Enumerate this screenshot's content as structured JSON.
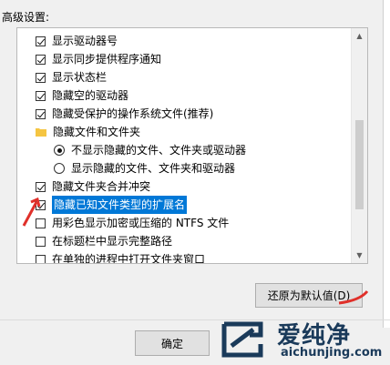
{
  "section_label": "高级设置:",
  "items": [
    {
      "type": "checkbox",
      "checked": true,
      "label": "显示驱动器号"
    },
    {
      "type": "checkbox",
      "checked": true,
      "label": "显示同步提供程序通知"
    },
    {
      "type": "checkbox",
      "checked": true,
      "label": "显示状态栏"
    },
    {
      "type": "checkbox",
      "checked": true,
      "label": "隐藏空的驱动器"
    },
    {
      "type": "checkbox",
      "checked": true,
      "label": "隐藏受保护的操作系统文件(推荐)"
    },
    {
      "type": "folder",
      "label": "隐藏文件和文件夹"
    },
    {
      "type": "radio",
      "selected": true,
      "label": "不显示隐藏的文件、文件夹或驱动器"
    },
    {
      "type": "radio",
      "selected": false,
      "label": "显示隐藏的文件、文件夹和驱动器"
    },
    {
      "type": "checkbox",
      "checked": true,
      "label": "隐藏文件夹合并冲突"
    },
    {
      "type": "checkbox",
      "checked": true,
      "label": "隐藏已知文件类型的扩展名",
      "highlighted": true
    },
    {
      "type": "checkbox",
      "checked": false,
      "label": "用彩色显示加密或压缩的 NTFS 文件"
    },
    {
      "type": "checkbox",
      "checked": false,
      "label": "在标题栏中显示完整路径"
    },
    {
      "type": "checkbox",
      "checked": false,
      "label": "在单独的进程中打开文件夹窗口"
    }
  ],
  "restore_button": "还原为默认值(D)",
  "ok_button": "确定",
  "watermark": {
    "text": "爱纯净",
    "url": "aichunjing.com"
  },
  "colors": {
    "highlight": "#0078d7",
    "annotation": "#e0302a",
    "logo": "#1a3a5a"
  }
}
